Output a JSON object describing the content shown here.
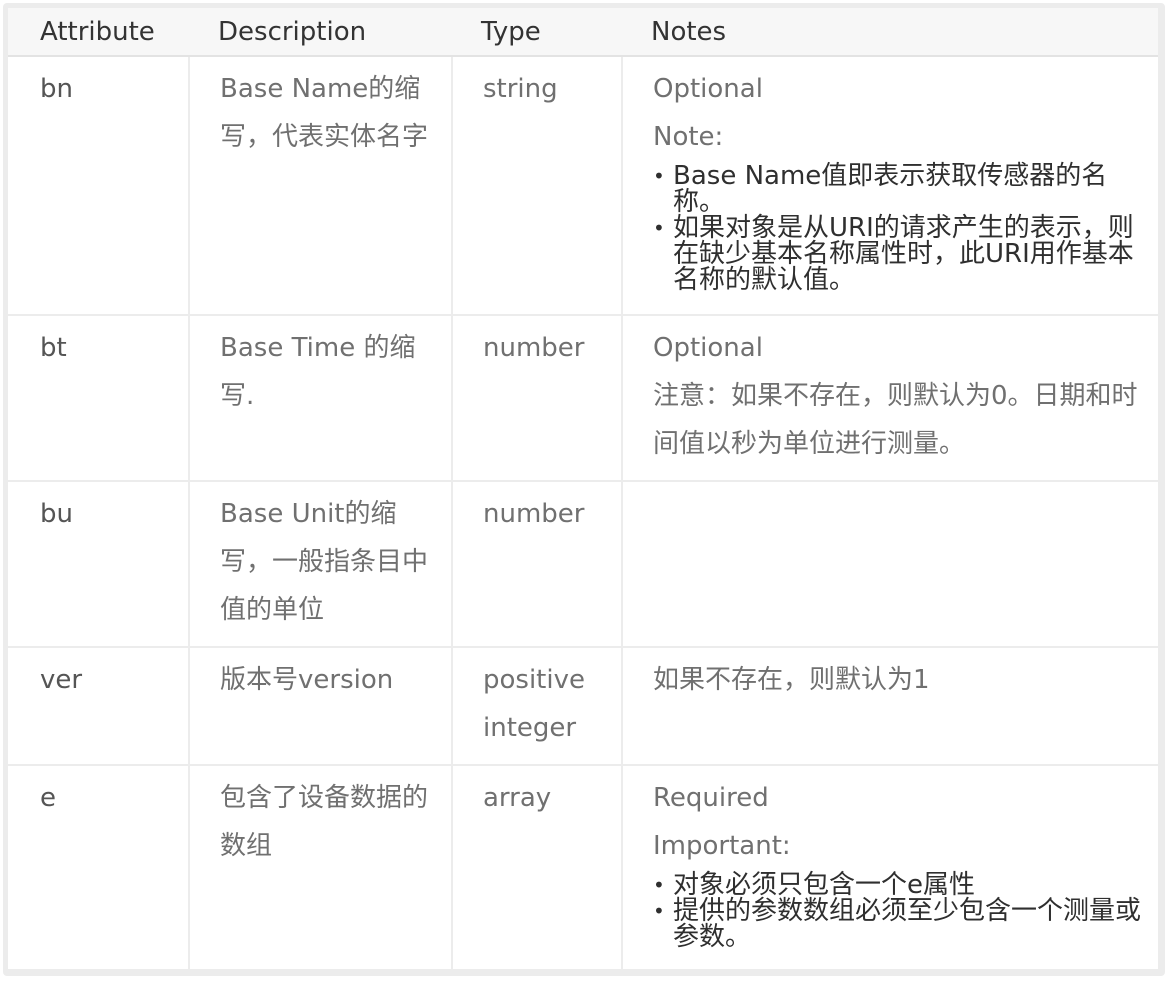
{
  "headers": {
    "attribute": "Attribute",
    "description": "Description",
    "type": "Type",
    "notes": "Notes"
  },
  "rows": [
    {
      "attribute": "bn",
      "description": "Base Name的缩写，代表实体名字",
      "type": "string",
      "notes_status": "Optional",
      "notes_label": "Note:",
      "bullets": [
        "Base Name值即表示获取传感器的名称。",
        "如果对象是从URI的请求产生的表示，则在缺少基本名称属性时，此URI用作基本名称的默认值。"
      ]
    },
    {
      "attribute": "bt",
      "description": "Base Time 的缩写.",
      "type": "number",
      "notes_status": "Optional",
      "notes_text": "注意：如果不存在，则默认为0。日期和时间值以秒为单位进行测量。"
    },
    {
      "attribute": "bu",
      "description": "Base Unit的缩写，一般指条目中值的单位",
      "type": "number"
    },
    {
      "attribute": "ver",
      "description": "版本号version",
      "type": "positive integer",
      "notes_text": "如果不存在，则默认为1"
    },
    {
      "attribute": "e",
      "description": "包含了设备数据的数组",
      "type": "array",
      "notes_status": "Required",
      "notes_label": "Important:",
      "bullets": [
        "对象必须只包含一个e属性",
        "提供的参数数组必须至少包含一个测量或参数。"
      ]
    }
  ]
}
